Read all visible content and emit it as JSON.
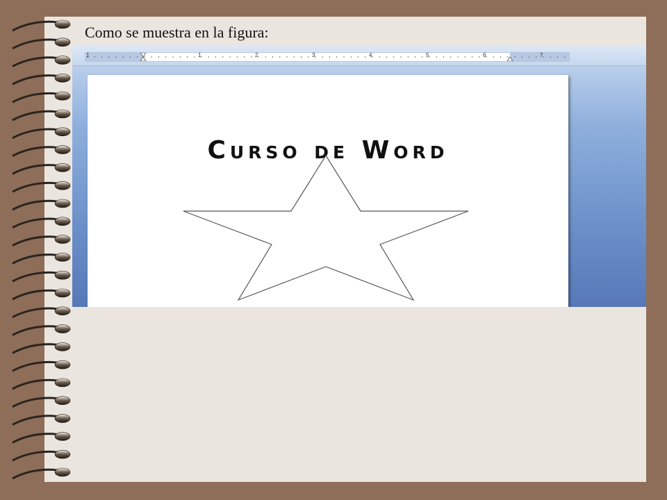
{
  "caption": "Como se muestra en la figura:",
  "ruler": {
    "numbers": [
      "1",
      "1",
      "2",
      "3",
      "4",
      "5",
      "6",
      "7"
    ]
  },
  "document": {
    "title": "Curso de Word",
    "shape": "star-icon"
  },
  "colors": {
    "frame": "#8e6e58",
    "page": "#ebe5e0",
    "word_background": "#6a8fc8",
    "doc_page": "#ffffff"
  }
}
